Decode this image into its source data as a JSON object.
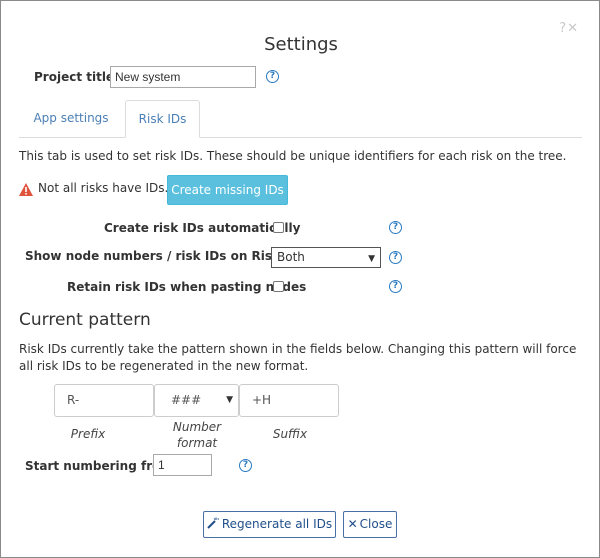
{
  "window": {
    "title": "Settings",
    "controls": "?✕"
  },
  "project": {
    "label": "Project title",
    "value": "New system"
  },
  "tabs": [
    {
      "label": "App settings",
      "active": false
    },
    {
      "label": "Risk IDs",
      "active": true
    }
  ],
  "risk_ids": {
    "intro": "This tab is used to set risk IDs. These should be unique identifiers for each risk on the tree.",
    "warning_text": "Not all risks have IDs.",
    "create_missing_label": "Create missing IDs",
    "auto_create_label": "Create risk IDs automatically",
    "auto_create_checked": false,
    "show_numbers_label": "Show node numbers / risk IDs on RiskTree",
    "show_numbers_value": "Both",
    "retain_label": "Retain risk IDs when pasting nodes",
    "retain_checked": false
  },
  "pattern": {
    "heading": "Current pattern",
    "description": "Risk IDs currently take the pattern shown in the fields below. Changing this pattern will force all risk IDs to be regenerated in the new format.",
    "prefix_value": "R-",
    "number_format_value": "###",
    "suffix_value": "+H",
    "prefix_label": "Prefix",
    "number_format_label": "Number format",
    "suffix_label": "Suffix",
    "start_label": "Start numbering from",
    "start_value": "1"
  },
  "footer": {
    "regenerate_label": "Regenerate all IDs",
    "close_label": "Close"
  },
  "icons": {
    "help": "question-circle-icon",
    "warning": "warning-triangle-icon",
    "wand": "magic-wand-icon",
    "close": "close-x-icon"
  },
  "colors": {
    "accent": "#5bc0de",
    "link": "#4b7fb5",
    "help": "#2a7ac0",
    "warning": "#e0533d"
  }
}
